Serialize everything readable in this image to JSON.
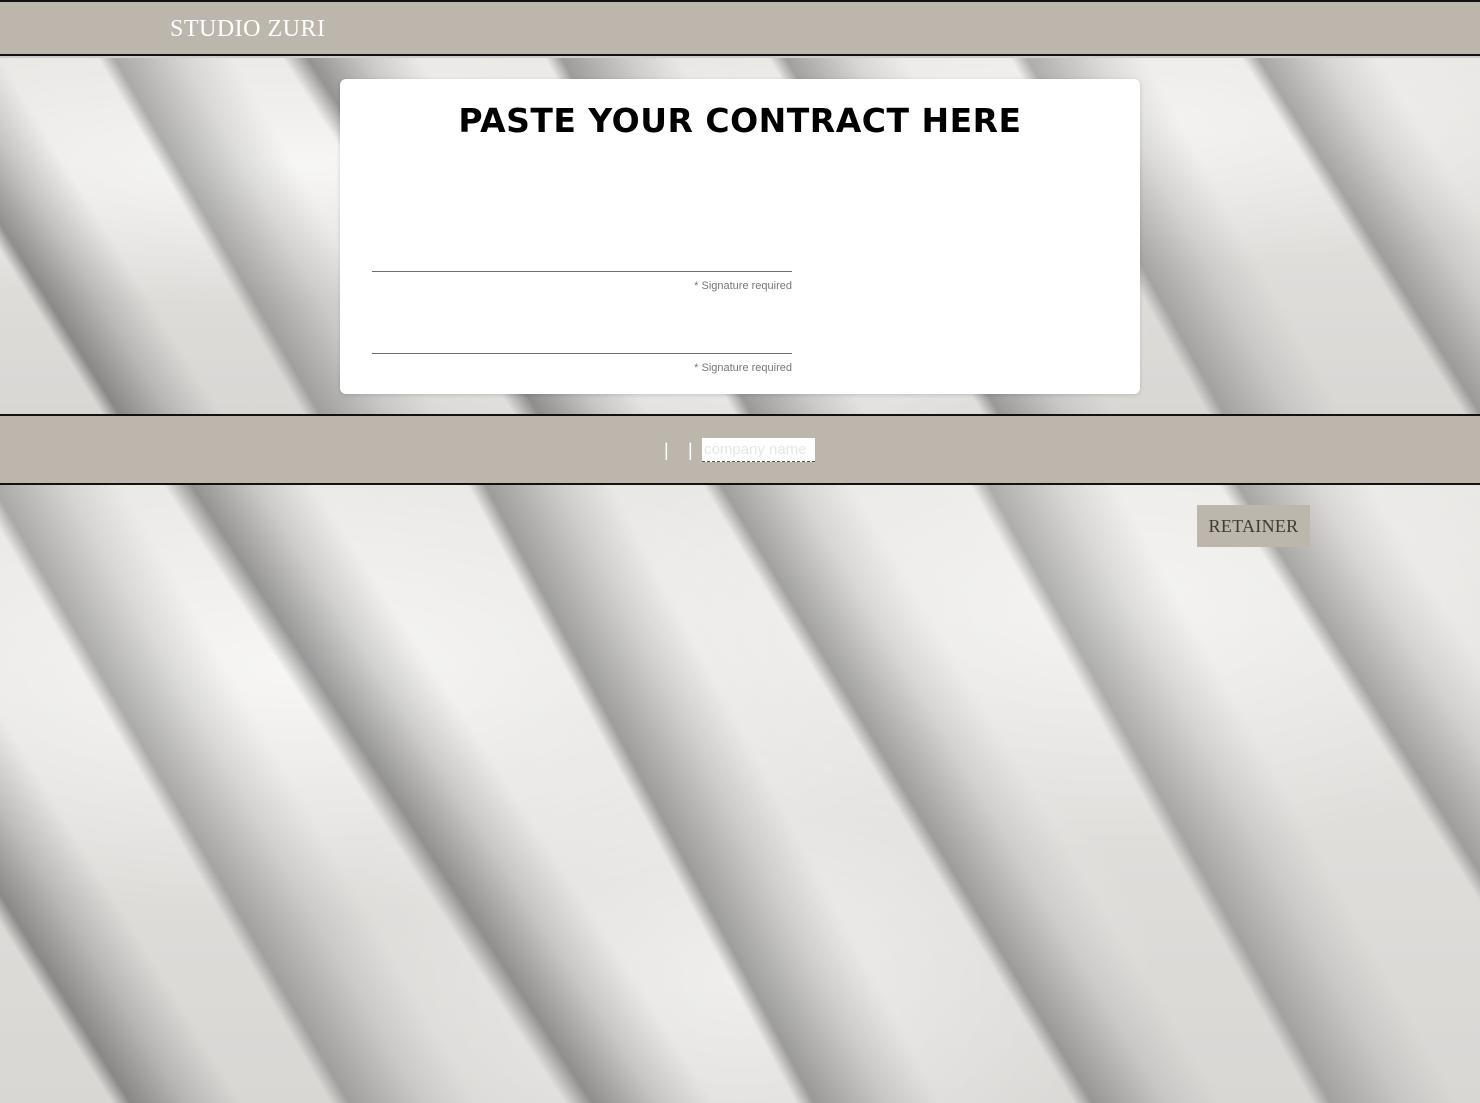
{
  "header": {
    "brand": "STUDIO ZURI"
  },
  "contract_card": {
    "title": "PASTE YOUR CONTRACT HERE",
    "signature_note_1": "* Signature required",
    "signature_note_2": "* Signature required"
  },
  "band": {
    "separator_1": "|",
    "separator_2": "|",
    "company_placeholder": "company name"
  },
  "retainer": {
    "label": "RETAINER"
  },
  "colors": {
    "taupe": "#bdb6ad",
    "white": "#ffffff",
    "title": "#000000"
  }
}
